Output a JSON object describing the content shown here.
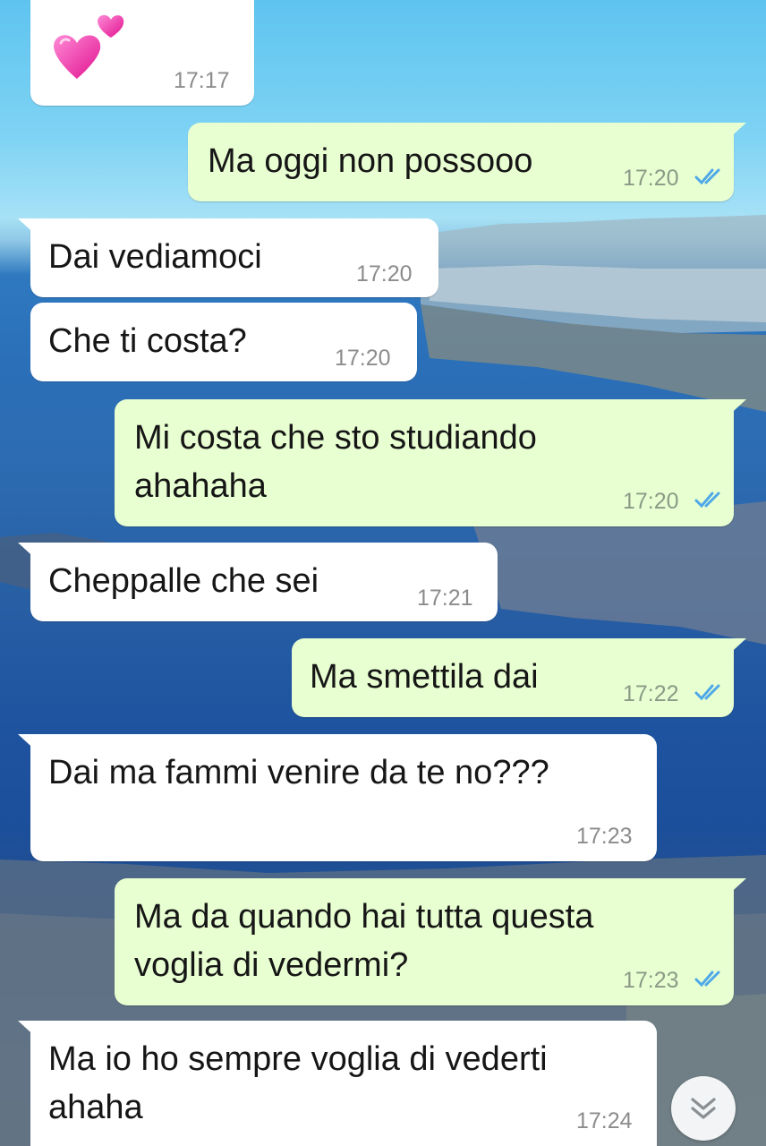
{
  "chat": {
    "messages": [
      {
        "id": "m1",
        "direction": "incoming",
        "sticker": "two-hearts-sticker",
        "time": "17:17"
      },
      {
        "id": "m2",
        "direction": "outgoing",
        "text": "Ma oggi non possooo",
        "time": "17:20",
        "status": "read"
      },
      {
        "id": "m3",
        "direction": "incoming",
        "text": "Dai vediamoci",
        "time": "17:20"
      },
      {
        "id": "m4",
        "direction": "incoming",
        "text": "Che ti costa?",
        "time": "17:20"
      },
      {
        "id": "m5",
        "direction": "outgoing",
        "text": "Mi costa che sto studiando\nahahaha",
        "time": "17:20",
        "status": "read"
      },
      {
        "id": "m6",
        "direction": "incoming",
        "text": "Cheppalle che sei",
        "time": "17:21"
      },
      {
        "id": "m7",
        "direction": "outgoing",
        "text": "Ma smettila dai",
        "time": "17:22",
        "status": "read"
      },
      {
        "id": "m8",
        "direction": "incoming",
        "text": "Dai ma fammi venire da te no???",
        "time": "17:23"
      },
      {
        "id": "m9",
        "direction": "outgoing",
        "text": "Ma da quando hai tutta questa\nvoglia di vedermi?",
        "time": "17:23",
        "status": "read"
      },
      {
        "id": "m10",
        "direction": "incoming",
        "text": "Ma io ho sempre voglia di vederti\nahaha",
        "time": "17:24"
      }
    ]
  },
  "scroll_button": {
    "icon": "double-chevron-down-icon"
  },
  "colors": {
    "incoming_bubble": "#ffffff",
    "outgoing_bubble": "#e8ffd2",
    "read_ticks": "#4fa8e8",
    "timestamp": "#8c8c8c"
  }
}
